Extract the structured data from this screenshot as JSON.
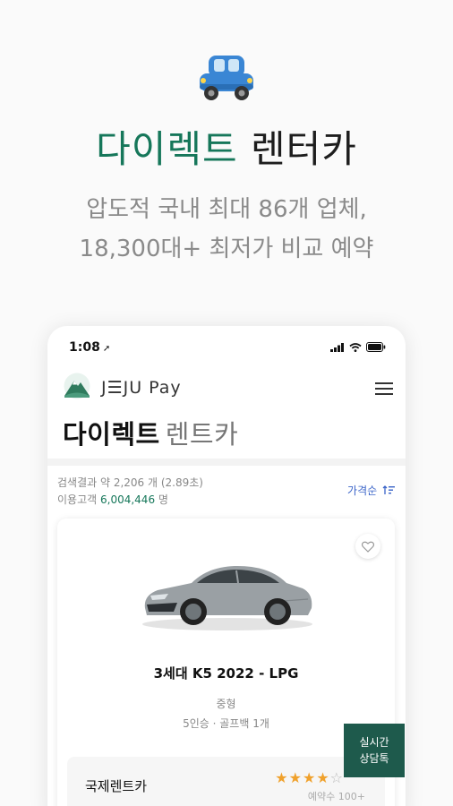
{
  "hero": {
    "title_accent": "다이렉트",
    "title_rest": "렌터카",
    "subtitle_line1": "압도적 국내 최대 86개 업체,",
    "subtitle_line2": "18,300대+ 최저가 비교 예약"
  },
  "status_bar": {
    "time": "1:08"
  },
  "app": {
    "brand": "J☰JU Pay",
    "page_title_bold": "다이렉트",
    "page_title_light": "렌트카"
  },
  "results": {
    "search_text": "검색결과 약 2,206 개 (2.89초)",
    "customers_label": "이용고객",
    "customers_value": "6,004,446",
    "customers_unit": "명",
    "sort_label": "가격순"
  },
  "car": {
    "name": "3세대 K5 2022 - LPG",
    "class": "중형",
    "spec": "5인승 · 골프백 1개"
  },
  "vendor": {
    "name": "국제렌트카",
    "rating": 4,
    "rating_max": 5,
    "bookings": "예약수 100+"
  },
  "chat": {
    "line1": "실시간",
    "line2": "상담톡"
  },
  "colors": {
    "accent": "#16775a",
    "chat_bg": "#1e5a4c",
    "sort_blue": "#3a64c8",
    "star": "#f0a12b"
  },
  "icons": [
    "car-icon",
    "location-arrow-icon",
    "signal-icon",
    "wifi-icon",
    "battery-icon",
    "mountain-logo-icon",
    "menu-icon",
    "sort-icon",
    "heart-icon",
    "star-icon"
  ]
}
